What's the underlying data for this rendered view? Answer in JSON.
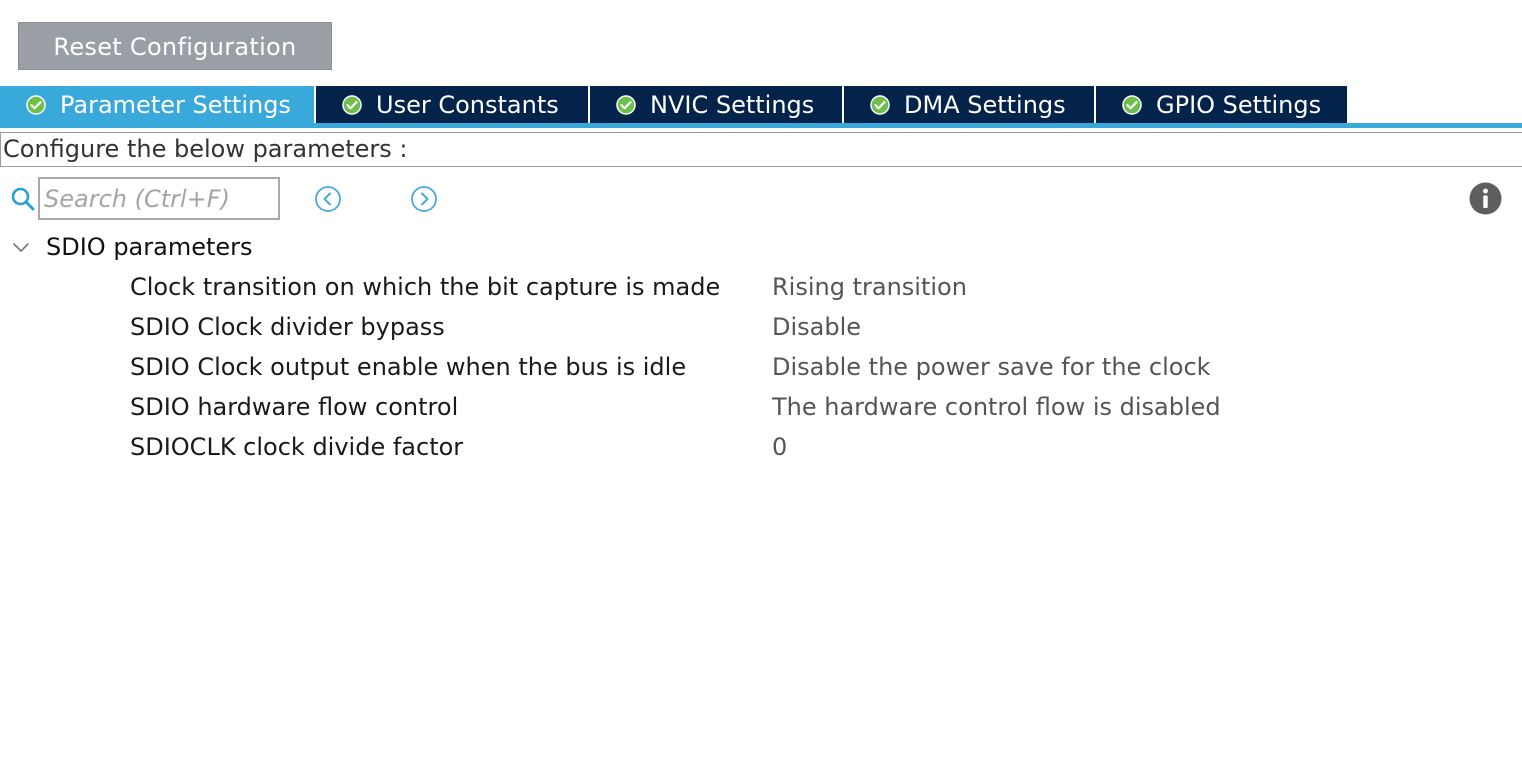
{
  "toolbar": {
    "reset_label": "Reset Configuration"
  },
  "tabs": [
    {
      "label": "Parameter Settings",
      "active": true
    },
    {
      "label": "User Constants",
      "active": false
    },
    {
      "label": "NVIC Settings",
      "active": false
    },
    {
      "label": "DMA Settings",
      "active": false
    },
    {
      "label": "GPIO Settings",
      "active": false
    }
  ],
  "configure_text": "Configure the below parameters :",
  "search": {
    "placeholder": "Search (Ctrl+F)",
    "value": ""
  },
  "icons": {
    "search": "search-icon",
    "prev": "circle-chevron-left-icon",
    "next": "circle-chevron-right-icon",
    "info": "info-icon",
    "tab_status": "check-circle-icon",
    "section_toggle": "chevron-down-icon"
  },
  "colors": {
    "accent": "#39a9dc",
    "tab_inactive": "#03234b",
    "reset_button": "#9a9fa5",
    "check_green": "#6cc04a"
  },
  "section": {
    "title": "SDIO parameters",
    "expanded": true,
    "params": [
      {
        "name": "Clock transition on which the bit capture is made",
        "value": "Rising transition"
      },
      {
        "name": "SDIO Clock divider bypass",
        "value": "Disable"
      },
      {
        "name": "SDIO Clock output enable when the bus is idle",
        "value": "Disable the power save for the clock"
      },
      {
        "name": "SDIO hardware flow control",
        "value": "The hardware control flow is disabled"
      },
      {
        "name": "SDIOCLK clock divide factor",
        "value": "0"
      }
    ]
  }
}
